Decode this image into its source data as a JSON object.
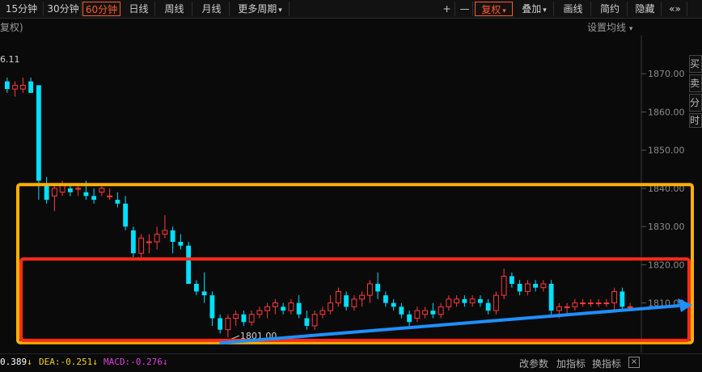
{
  "toolbar": {
    "tabs": [
      {
        "label": "15分钟",
        "active": false,
        "dropdown": false
      },
      {
        "label": "30分钟",
        "active": false,
        "dropdown": false
      },
      {
        "label": "60分钟",
        "active": true,
        "dropdown": false
      },
      {
        "label": "日线",
        "active": false,
        "dropdown": false
      },
      {
        "label": "周线",
        "active": false,
        "dropdown": false
      },
      {
        "label": "月线",
        "active": false,
        "dropdown": false
      },
      {
        "label": "更多周期",
        "active": false,
        "dropdown": true
      }
    ],
    "right": [
      {
        "label": "+",
        "active": false,
        "dropdown": false
      },
      {
        "label": "—",
        "active": false,
        "dropdown": false
      },
      {
        "label": "复权",
        "active": true,
        "dropdown": true
      },
      {
        "label": "叠加",
        "active": false,
        "dropdown": true
      },
      {
        "label": "画线",
        "active": false,
        "dropdown": false
      },
      {
        "label": "简约",
        "active": false,
        "dropdown": false
      },
      {
        "label": "隐藏",
        "active": false,
        "dropdown": false
      },
      {
        "label": "«»",
        "active": false,
        "dropdown": false
      }
    ]
  },
  "subbar": {
    "left": "复权)",
    "right": "设置均线"
  },
  "indicators": [
    {
      "text": "0.389",
      "arrow": "↓",
      "color": "#ffffff"
    },
    {
      "text": "DEA:-0.251",
      "arrow": "↓",
      "color": "#f0d020"
    },
    {
      "text": "MACD:-0.276",
      "arrow": "↓",
      "color": "#e040e0"
    }
  ],
  "bottom_buttons": [
    "改参数",
    "加指标",
    "换指标"
  ],
  "close_label": "×",
  "right_panel": [
    "买",
    "卖",
    "分",
    "时"
  ],
  "colors": {
    "up": "#ff3b3b",
    "down": "#00e0ff",
    "box_yellow": "#ffb000",
    "box_red": "#ff2a1a",
    "trend": "#1e90ff"
  },
  "chart_data": {
    "type": "candlestick",
    "title": "",
    "ylim": [
      1797,
      1880
    ],
    "yticks": [
      "1870.00",
      "1860.00",
      "1850.00",
      "1840.00",
      "1830.00",
      "1820.00",
      "1810.00"
    ],
    "top_label": "6.11",
    "low_annotation": "1801.00",
    "candles": [
      [
        1868,
        1869,
        1865,
        1866
      ],
      [
        1866,
        1868,
        1864,
        1867
      ],
      [
        1866,
        1869,
        1865,
        1867
      ],
      [
        1868,
        1869,
        1865,
        1865
      ],
      [
        1867,
        1867,
        1837,
        1842
      ],
      [
        1841,
        1843,
        1836,
        1837
      ],
      [
        1838,
        1841,
        1834,
        1840
      ],
      [
        1839,
        1842,
        1838,
        1841
      ],
      [
        1840,
        1841,
        1838,
        1839
      ],
      [
        1840,
        1841,
        1838,
        1840
      ],
      [
        1839,
        1842,
        1837,
        1838
      ],
      [
        1838,
        1840,
        1836,
        1837
      ],
      [
        1839,
        1841,
        1838,
        1840
      ],
      [
        1838,
        1840,
        1837,
        1838
      ],
      [
        1837,
        1839,
        1835,
        1836
      ],
      [
        1836,
        1838,
        1829,
        1830
      ],
      [
        1829,
        1830,
        1822,
        1823
      ],
      [
        1823,
        1828,
        1822,
        1827
      ],
      [
        1826,
        1828,
        1823,
        1826
      ],
      [
        1826,
        1830,
        1824,
        1828
      ],
      [
        1828,
        1833,
        1827,
        1829
      ],
      [
        1829,
        1830,
        1823,
        1826
      ],
      [
        1826,
        1828,
        1824,
        1825
      ],
      [
        1825,
        1826,
        1815,
        1815
      ],
      [
        1815,
        1816,
        1812,
        1813
      ],
      [
        1813,
        1818,
        1810,
        1812
      ],
      [
        1812,
        1813,
        1804,
        1806
      ],
      [
        1806,
        1807,
        1802,
        1803
      ],
      [
        1803,
        1807,
        1801,
        1806
      ],
      [
        1806,
        1808,
        1804,
        1807
      ],
      [
        1807,
        1808,
        1804,
        1805
      ],
      [
        1805,
        1808,
        1804,
        1807
      ],
      [
        1807,
        1809,
        1806,
        1808
      ],
      [
        1808,
        1810,
        1806,
        1809
      ],
      [
        1809,
        1811,
        1807,
        1810
      ],
      [
        1809,
        1810,
        1807,
        1808
      ],
      [
        1808,
        1811,
        1807,
        1810
      ],
      [
        1810,
        1812,
        1806,
        1807
      ],
      [
        1806,
        1808,
        1803,
        1804
      ],
      [
        1804,
        1808,
        1803,
        1807
      ],
      [
        1807,
        1809,
        1806,
        1808
      ],
      [
        1808,
        1812,
        1807,
        1810
      ],
      [
        1810,
        1814,
        1809,
        1813
      ],
      [
        1812,
        1813,
        1808,
        1809
      ],
      [
        1809,
        1812,
        1808,
        1811
      ],
      [
        1811,
        1813,
        1809,
        1812
      ],
      [
        1812,
        1816,
        1810,
        1815
      ],
      [
        1815,
        1818,
        1811,
        1813
      ],
      [
        1812,
        1813,
        1809,
        1810
      ],
      [
        1810,
        1811,
        1808,
        1809
      ],
      [
        1809,
        1810,
        1806,
        1807
      ],
      [
        1807,
        1808,
        1804,
        1805
      ],
      [
        1806,
        1809,
        1805,
        1808
      ],
      [
        1807,
        1809,
        1806,
        1808
      ],
      [
        1808,
        1810,
        1806,
        1807
      ],
      [
        1807,
        1810,
        1806,
        1809
      ],
      [
        1809,
        1812,
        1808,
        1811
      ],
      [
        1810,
        1812,
        1809,
        1811
      ],
      [
        1811,
        1812,
        1809,
        1810
      ],
      [
        1810,
        1812,
        1809,
        1811
      ],
      [
        1811,
        1812,
        1809,
        1810
      ],
      [
        1810,
        1811,
        1807,
        1808
      ],
      [
        1808,
        1813,
        1807,
        1812
      ],
      [
        1812,
        1819,
        1811,
        1817
      ],
      [
        1817,
        1818,
        1814,
        1815
      ],
      [
        1815,
        1816,
        1812,
        1813
      ],
      [
        1813,
        1816,
        1812,
        1815
      ],
      [
        1815,
        1816,
        1813,
        1814
      ],
      [
        1814,
        1816,
        1813,
        1815
      ],
      [
        1815,
        1816,
        1807,
        1808
      ],
      [
        1808,
        1810,
        1806,
        1809
      ],
      [
        1809,
        1810,
        1807,
        1809
      ],
      [
        1809,
        1811,
        1808,
        1810
      ],
      [
        1810,
        1811,
        1809,
        1810
      ],
      [
        1810,
        1811,
        1809,
        1810
      ],
      [
        1810,
        1811,
        1809,
        1810
      ],
      [
        1810,
        1811,
        1809,
        1810
      ],
      [
        1810,
        1814,
        1808,
        1813
      ],
      [
        1813,
        1814,
        1808,
        1809
      ],
      [
        1809,
        1810,
        1808,
        1809
      ]
    ],
    "trend_line": {
      "x": [
        30,
        80
      ],
      "y": [
        1799.5,
        1809.5
      ]
    },
    "boxes": [
      {
        "name": "yellow-range",
        "x": [
          0,
          80
        ],
        "y": [
          1799.6,
          1841
        ]
      },
      {
        "name": "red-range",
        "x": [
          0,
          80
        ],
        "y": [
          1800.2,
          1821.5
        ]
      }
    ]
  }
}
